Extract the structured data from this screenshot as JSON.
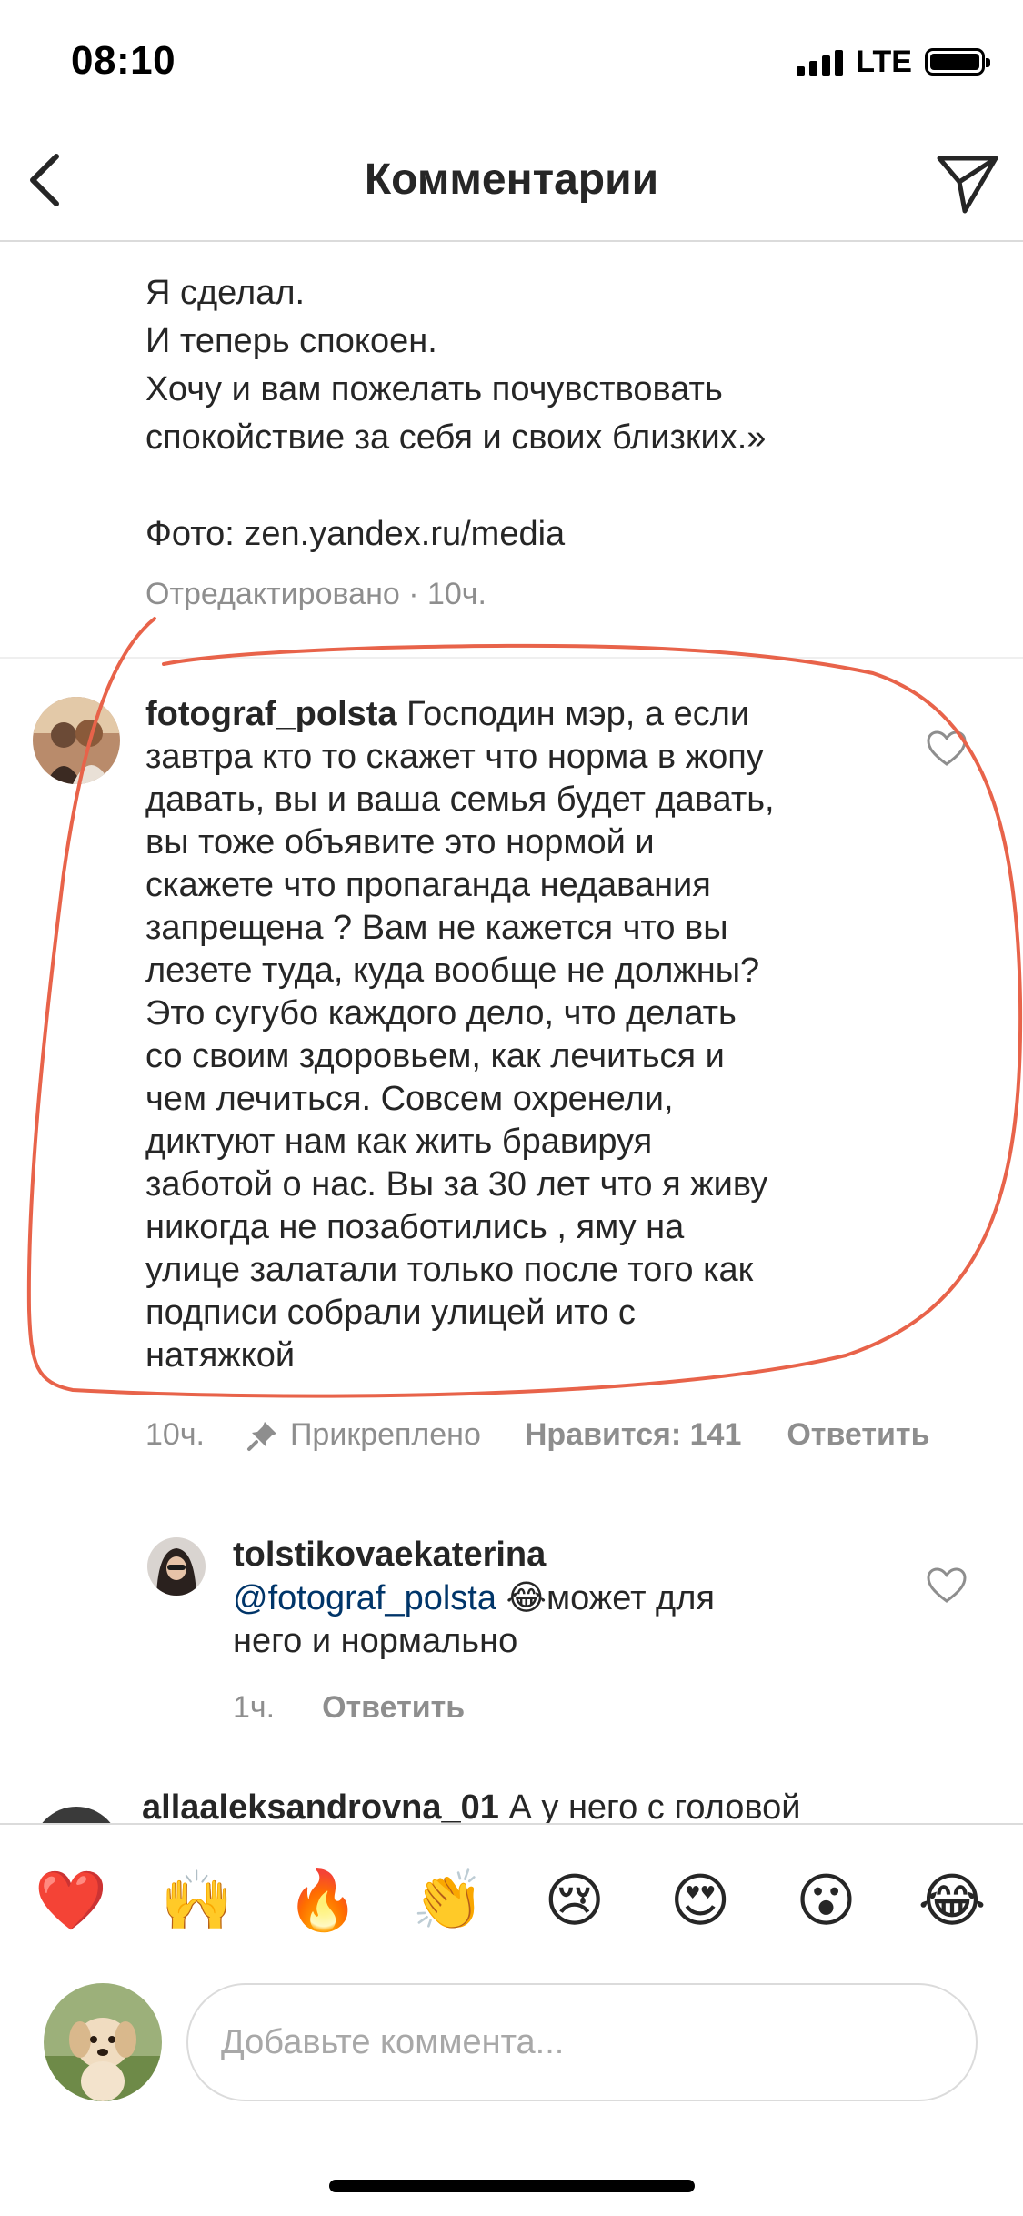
{
  "status_bar": {
    "time": "08:10",
    "network": "LTE"
  },
  "header": {
    "title": "Комментарии"
  },
  "post": {
    "caption_lines": [
      "Я сделал.",
      "И теперь спокоен.",
      "Хочу и вам пожелать почувствовать",
      "спокойствие за себя и своих близких.»",
      "",
      "Фото: zen.yandex.ru/media"
    ],
    "edited_meta": "Отредактировано · 10ч."
  },
  "comment": {
    "username": "fotograf_polsta",
    "first_line_text": " Господин мэр, а если",
    "lines": [
      "завтра кто то скажет что норма в жопу",
      "давать, вы и ваша семья будет давать,",
      "вы тоже объявите это нормой и",
      "скажете что пропаганда недавания",
      "запрещена ? Вам не кажется что вы",
      "лезете туда, куда вообще не должны?",
      "Это сугубо каждого дело, что делать",
      "со своим здоровьем, как лечиться и",
      "чем лечиться. Совсем охренели,",
      "диктуют нам  как жить бравируя",
      "заботой о нас. Вы за 30 лет что я живу",
      "никогда не позаботились , яму на",
      "улице залатали только после того как",
      "подписи собрали улицей ито с",
      "натяжкой"
    ],
    "time": "10ч.",
    "pinned_label": "Прикреплено",
    "likes_label": "Нравится: 141",
    "reply_label": "Ответить"
  },
  "reply": {
    "username": "tolstikovaekaterina",
    "mention": "@fotograf_polsta",
    "emoji": "😂",
    "text_after": "может для",
    "line2": "него и нормально",
    "time": "1ч.",
    "reply_label": "Ответить"
  },
  "partial_comment": {
    "username": "allaaleksandrovna_01",
    "text": " А у него с головой"
  },
  "emoji_bar": [
    "❤️",
    "🙌",
    "🔥",
    "👏",
    "😢",
    "😍",
    "😮",
    "😂"
  ],
  "comment_input": {
    "placeholder": "Добавьте коммента..."
  },
  "colors": {
    "annotation_circle": "#e8634a",
    "mention": "#003569",
    "meta_gray": "#8e8e8e"
  },
  "icons": {
    "back": "chevron-left-icon",
    "send": "paper-plane-icon",
    "like": "heart-outline-icon",
    "pin": "pin-icon"
  }
}
